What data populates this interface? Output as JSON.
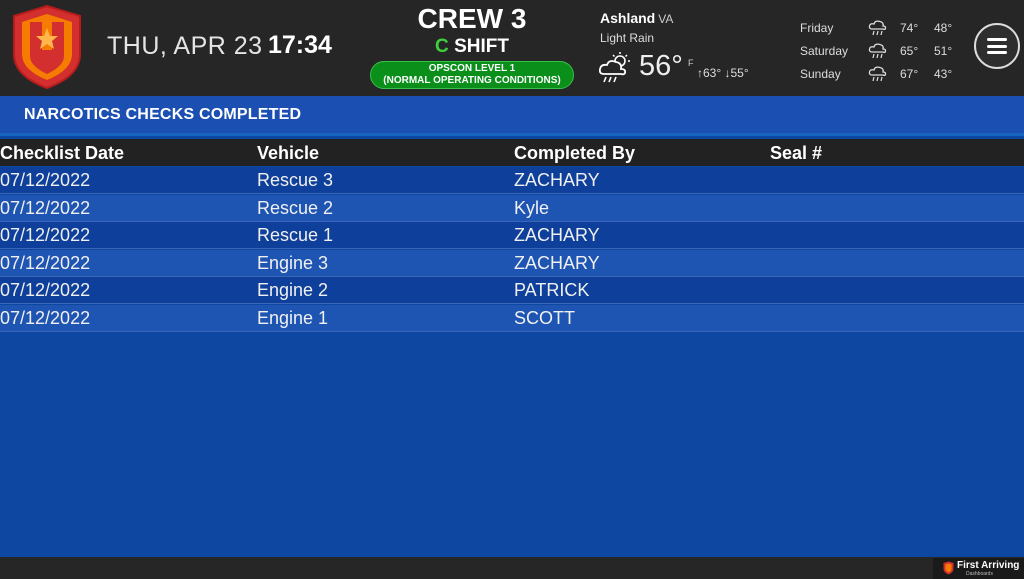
{
  "header": {
    "date": "THU, APR 23",
    "time": "17:34",
    "crew": "CREW 3",
    "shift_letter": "C",
    "shift_word": "SHIFT",
    "opscon_line1": "OPSCON LEVEL 1",
    "opscon_line2": "(NORMAL OPERATING CONDITIONS)",
    "opscon_color": "#0a8f1a"
  },
  "weather": {
    "city": "Ashland",
    "state": "VA",
    "condition": "Light Rain",
    "icon": "rain-cloud-sun-icon",
    "temp": "56°",
    "unit": "F",
    "high": "63°",
    "low": "55°",
    "forecast": [
      {
        "day": "Friday",
        "high": "74°",
        "low": "48°",
        "icon": "rain-cloud-icon"
      },
      {
        "day": "Saturday",
        "high": "65°",
        "low": "51°",
        "icon": "rain-cloud-icon"
      },
      {
        "day": "Sunday",
        "high": "67°",
        "low": "43°",
        "icon": "rain-cloud-icon"
      }
    ]
  },
  "section": {
    "title": "NARCOTICS CHECKS COMPLETED"
  },
  "table": {
    "columns": [
      "Checklist Date",
      "Vehicle",
      "Completed By",
      "Seal #"
    ],
    "rows": [
      [
        "07/12/2022",
        "Rescue 3",
        "ZACHARY",
        ""
      ],
      [
        "07/12/2022",
        "Rescue 2",
        "Kyle",
        ""
      ],
      [
        "07/12/2022",
        "Rescue 1",
        "ZACHARY",
        ""
      ],
      [
        "07/12/2022",
        "Engine 3",
        "ZACHARY",
        ""
      ],
      [
        "07/12/2022",
        "Engine 2",
        "PATRICK",
        ""
      ],
      [
        "07/12/2022",
        "Engine 1",
        "SCOTT",
        ""
      ]
    ]
  },
  "footer": {
    "brand": "First Arriving",
    "brand_sub": "Dashboards"
  },
  "colors": {
    "background": "#0d47a1",
    "header": "#262626",
    "accent_green": "#3ecf3e"
  }
}
